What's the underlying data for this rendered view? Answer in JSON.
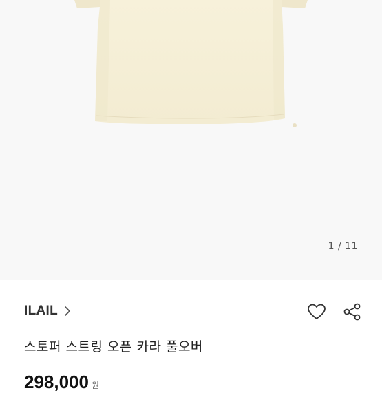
{
  "gallery": {
    "current_page": 1,
    "total_pages": 11,
    "indicator_text": "1 / 11",
    "product_color": "#f6f0d8"
  },
  "product": {
    "brand": "ILAIL",
    "title": "스토퍼 스트링 오픈 카라 풀오버",
    "price": "298,000",
    "currency": "원"
  },
  "icons": {
    "brand_link": "chevron-right-icon",
    "like": "heart-icon",
    "share": "share-icon"
  }
}
